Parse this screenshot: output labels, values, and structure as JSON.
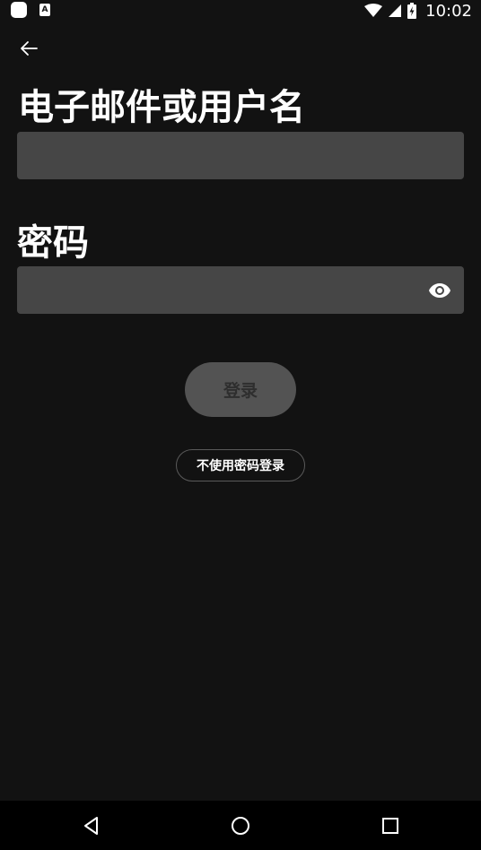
{
  "status_bar": {
    "time": "10:02",
    "icons": [
      "app-icon",
      "a-notification-icon",
      "wifi-icon",
      "signal-icon",
      "battery-charging-icon"
    ],
    "a_icon_glyph": "A"
  },
  "header": {
    "back_icon": "arrow-left-icon"
  },
  "form": {
    "email_label": "电子邮件或用户名",
    "email_value": "",
    "email_placeholder": "",
    "password_label": "密码",
    "password_value": "",
    "password_placeholder": "",
    "show_password_icon": "eye-icon"
  },
  "actions": {
    "login_label": "登录",
    "passwordless_label": "不使用密码登录"
  },
  "nav_bar": {
    "icons": [
      "nav-back-icon",
      "nav-home-icon",
      "nav-recents-icon"
    ]
  },
  "colors": {
    "background": "#121212",
    "input_background": "#464646",
    "button_disabled": "#535353",
    "button_disabled_text": "#2e2e2e",
    "text": "#ffffff",
    "nav_bar": "#000000"
  }
}
